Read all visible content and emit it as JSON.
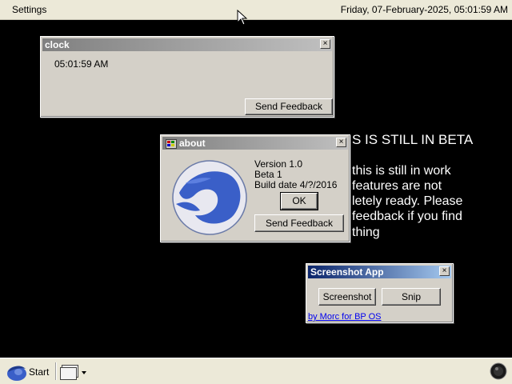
{
  "topbar": {
    "settings_label": "Settings",
    "datetime": "Friday, 07-February-2025, 05:01:59 AM"
  },
  "background_text": {
    "title": "S IS STILL IN BETA",
    "lines": [
      "this is still in work",
      "features are not",
      "letely ready. Please",
      "feedback if you find",
      "thing"
    ]
  },
  "clock_window": {
    "title": "clock",
    "close_label": "×",
    "time": "05:01:59 AM",
    "feedback_label": "Send Feedback"
  },
  "about_window": {
    "title": "about",
    "close_label": "×",
    "version": "Version 1.0",
    "beta": "Beta 1",
    "build_date": "Build date 4/?/2016",
    "ok_label": "OK",
    "feedback_label": "Send Feedback"
  },
  "screenshot_window": {
    "title": "Screenshot App",
    "close_label": "×",
    "screenshot_label": "Screenshot",
    "snip_label": "Snip",
    "credit_link": "by Morc for BP OS"
  },
  "taskbar": {
    "start_label": "Start",
    "icons": [
      "start-logo-icon",
      "window-switcher-icon",
      "chevron-down-icon",
      "tray-orb-icon"
    ]
  },
  "colors": {
    "desktop": "#000000",
    "chrome": "#d4d0c8",
    "taskbar": "#ece9d8",
    "link": "#0000ee",
    "active_title": "#0a246a",
    "logo_blue": "#3a5fc8"
  }
}
